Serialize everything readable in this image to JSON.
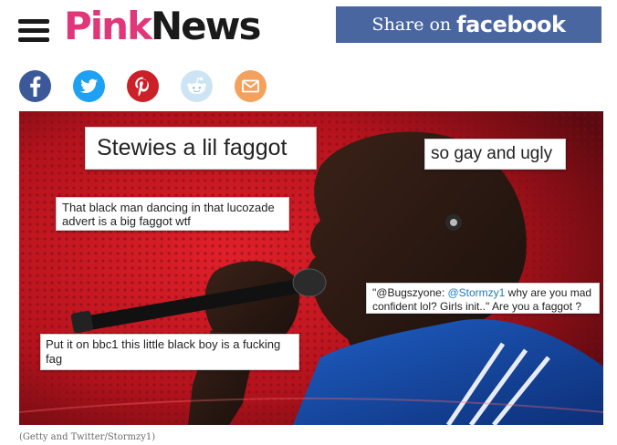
{
  "header": {
    "logo_pink": "Pink",
    "logo_news": "News",
    "share": {
      "prefix": "Share on",
      "brand": "facebook"
    }
  },
  "social": [
    {
      "name": "facebook",
      "icon": "facebook-icon",
      "color": "#3b5998"
    },
    {
      "name": "twitter",
      "icon": "twitter-icon",
      "color": "#1da1f2"
    },
    {
      "name": "pinterest",
      "icon": "pinterest-icon",
      "color": "#cb2027"
    },
    {
      "name": "reddit",
      "icon": "reddit-icon",
      "color": "#cde4f4"
    },
    {
      "name": "email",
      "icon": "mail-icon",
      "color": "#f4a15d"
    }
  ],
  "hero": {
    "quote1": "Stewies a lil faggot",
    "quote2": "so gay and ugly",
    "quote3": "That black man dancing in that lucozade advert is a big faggot wtf",
    "quote4_prefix": "\"@Bugszyone: ",
    "quote4_mention": "@Stormzy1",
    "quote4_suffix": " why are you mad confident lol? Girls init..\" Are you a faggot ?",
    "quote5": "Put it on bbc1 this little black boy is a fucking fag"
  },
  "caption": "(Getty and Twitter/Stormzy1)",
  "colors": {
    "brand_pink": "#e0367a",
    "facebook_blue": "#4a66a0",
    "hero_red": "#c4161c"
  }
}
